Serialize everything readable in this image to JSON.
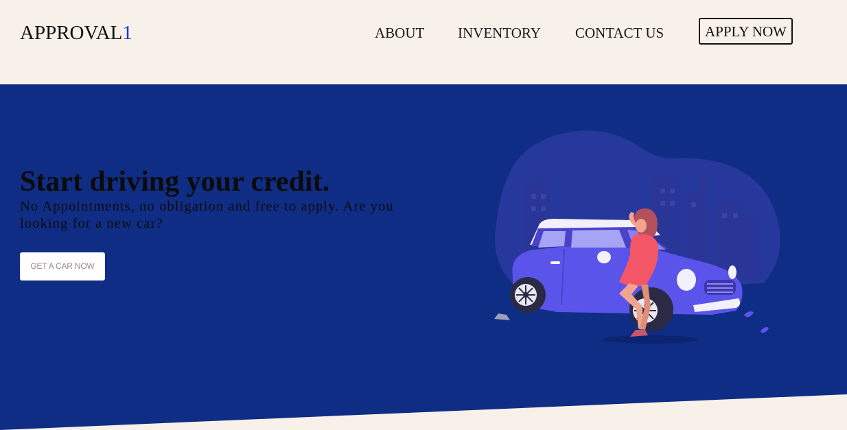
{
  "header": {
    "logo_text": "APPROVAL",
    "logo_accent": "1",
    "nav": {
      "about": "ABOUT",
      "inventory": "INVENTORY",
      "contact": "CONTACT US"
    },
    "apply_label": "APPLY NOW"
  },
  "hero": {
    "title": "Start driving your credit.",
    "subtitle": "No Appointments, no obligation and free to apply. Are you looking for a new car?",
    "cta_label": "GET A CAR NOW"
  },
  "colors": {
    "page_background": "#f8f1ea",
    "hero_background": "#0f2d84",
    "logo_accent": "#1a33d6",
    "car_body": "#5b54ea",
    "dress": "#f25667"
  },
  "illustration": {
    "subject": "woman-leaning-on-car-icon"
  }
}
